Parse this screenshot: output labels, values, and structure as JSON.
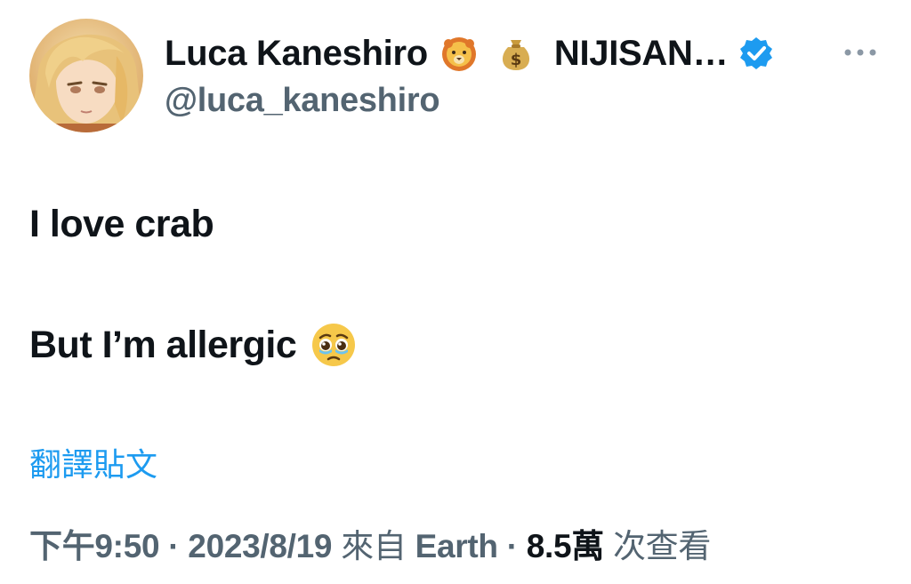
{
  "author": {
    "display_name": "Luca Kaneshiro",
    "name_emoji_1": "lion-face-icon",
    "name_emoji_2": "money-bag-icon",
    "org_name": "NIJISAN…",
    "verified_icon": "verified-badge-icon",
    "handle": "@luca_kaneshiro"
  },
  "tweet": {
    "line1": "I love crab",
    "line2": "But I’m allergic",
    "line2_emoji": "pleading-face-tear-icon"
  },
  "actions": {
    "translate_label": "翻譯貼文",
    "more_icon": "more-options-icon"
  },
  "meta": {
    "time": "下午9:50",
    "separator": "·",
    "date": "2023/8/19",
    "source_prefix": "來自",
    "source": "Earth",
    "views_count": "8.5萬",
    "views_label": "次查看"
  },
  "colors": {
    "text": "#0f1419",
    "secondary": "#536471",
    "accent": "#1d9bf0"
  }
}
